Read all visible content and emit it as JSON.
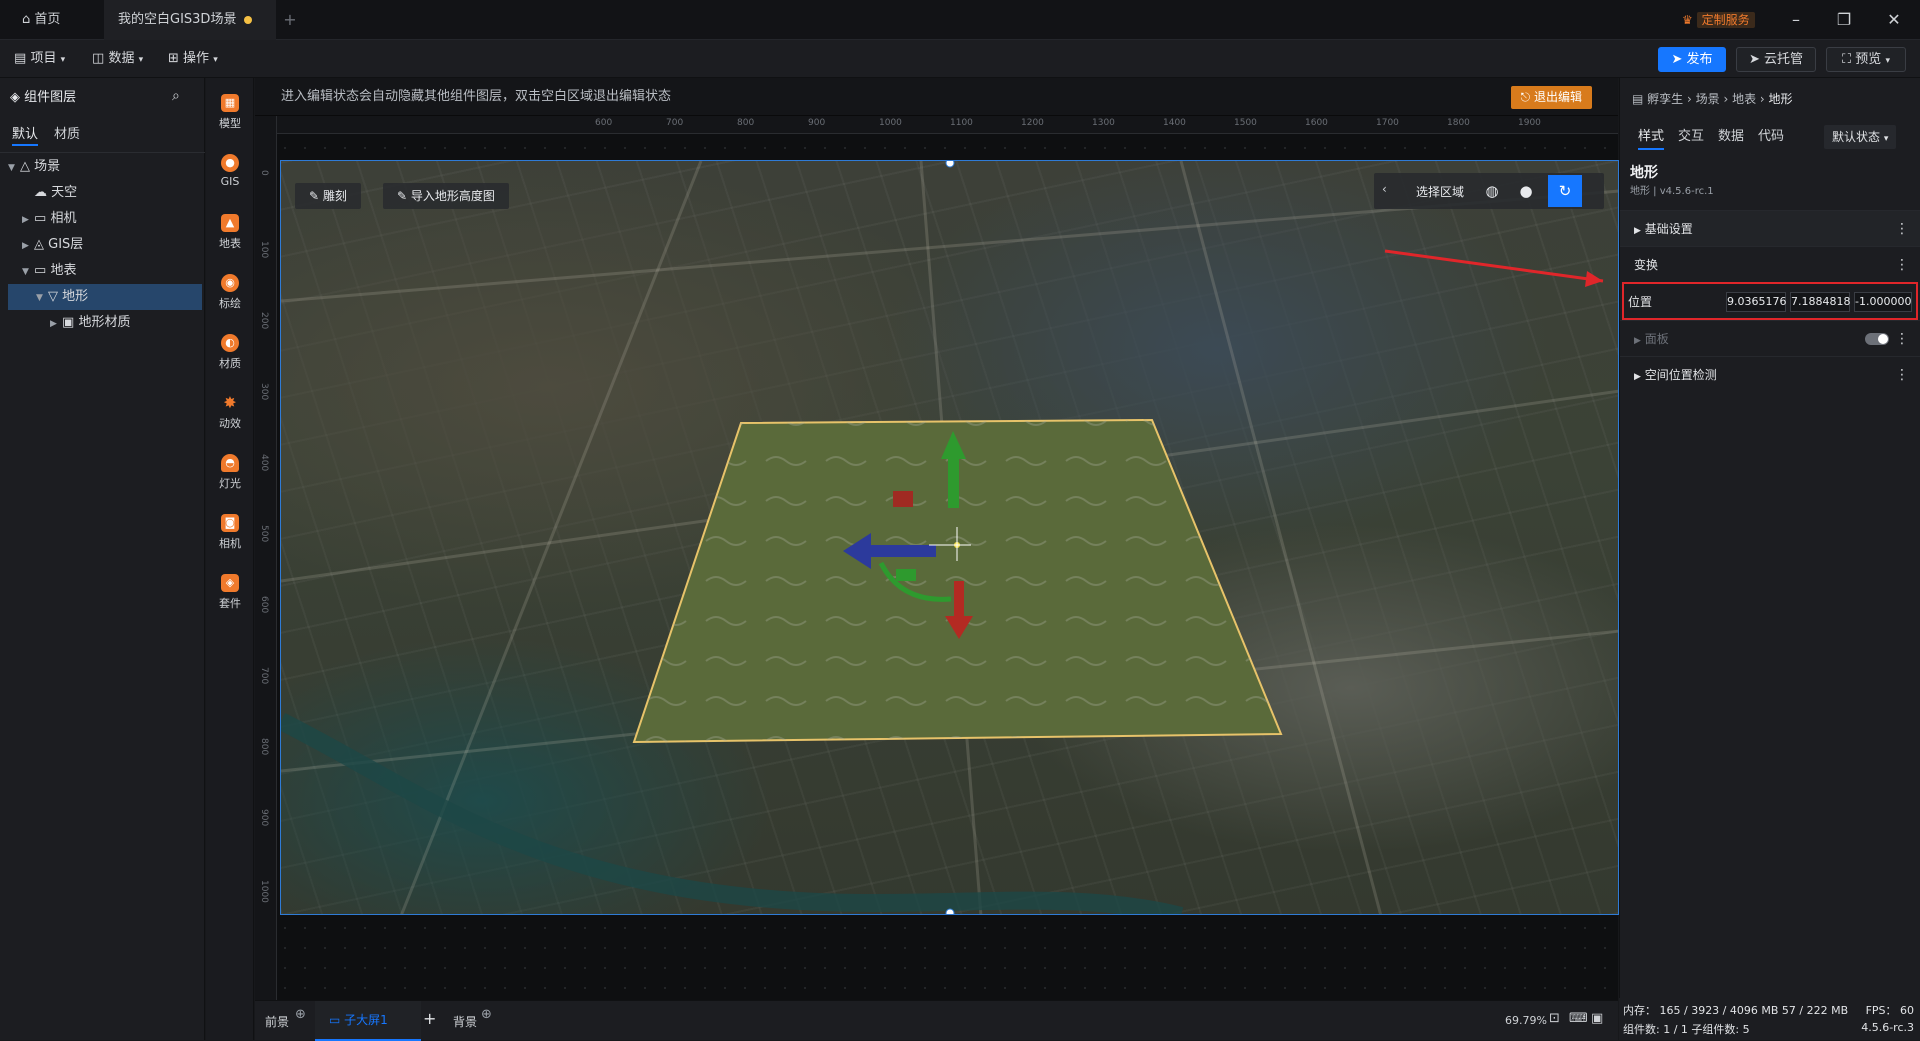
{
  "titlebar": {
    "tabs": [
      {
        "label": "首页"
      },
      {
        "label": "我的空白GIS3D场景"
      }
    ],
    "new_tab": "+",
    "custom_service": "定制服务",
    "win_min": "–",
    "win_max": "❐",
    "win_close": "✕"
  },
  "menubar": {
    "items": [
      {
        "label": "项目"
      },
      {
        "label": "数据"
      },
      {
        "label": "操作"
      }
    ],
    "publish": "发布",
    "cloud": "云托管",
    "preview": "预览"
  },
  "layers": {
    "title": "组件图层",
    "tabs": [
      "默认",
      "材质"
    ],
    "tree": [
      {
        "label": "场景"
      },
      {
        "label": "天空"
      },
      {
        "label": "相机"
      },
      {
        "label": "GIS层"
      },
      {
        "label": "地表"
      },
      {
        "label": "地形"
      },
      {
        "label": "地形材质"
      }
    ]
  },
  "tools": [
    {
      "label": "模型",
      "icon": "cube-icon"
    },
    {
      "label": "GIS",
      "icon": "globe-icon"
    },
    {
      "label": "地表",
      "icon": "terrain-icon"
    },
    {
      "label": "标绘",
      "icon": "pin-icon"
    },
    {
      "label": "材质",
      "icon": "material-icon"
    },
    {
      "label": "动效",
      "icon": "effect-icon"
    },
    {
      "label": "灯光",
      "icon": "light-icon"
    },
    {
      "label": "相机",
      "icon": "camera-icon"
    },
    {
      "label": "套件",
      "icon": "kit-icon"
    }
  ],
  "canvas": {
    "hint": "进入编辑状态会自动隐藏其他组件图层，双击空白区域退出编辑状态",
    "exit_edit": "退出编辑",
    "ruler_top": [
      "600",
      "700",
      "800",
      "900",
      "1000",
      "1100",
      "1200",
      "1300",
      "1400",
      "1500",
      "1600",
      "1700",
      "1800",
      "1900"
    ],
    "ruler_left": [
      "0",
      "100",
      "200",
      "300",
      "400",
      "500",
      "600",
      "700",
      "800",
      "900",
      "1000"
    ],
    "sculpt": "雕刻",
    "import_height": "导入地形高度图",
    "select_area": "选择区域"
  },
  "inspector": {
    "breadcrumb": [
      "孵孪生",
      "场景",
      "地表",
      "地形"
    ],
    "tabs": [
      "样式",
      "交互",
      "数据",
      "代码"
    ],
    "state": "默认状态",
    "title": "地形",
    "subtitle": "地形 | v4.5.6-rc.1",
    "sections": {
      "basic": "基础设置",
      "transform": "变换",
      "position_label": "位置",
      "position": [
        "9.0365176",
        "7.1884818",
        "-1.000000"
      ],
      "panel": "面板",
      "spatial": "空间位置检测"
    }
  },
  "bottombar": {
    "front": "前景",
    "screen": "子大屏1",
    "background": "背景",
    "zoom": "69.79%"
  },
  "status": {
    "memory": "内存： 165 / 3923 / 4096 MB  57 / 222 MB",
    "fps": "FPS：  60",
    "components": "组件数: 1 / 1    子组件数: 5",
    "version": "4.5.6-rc.3"
  }
}
